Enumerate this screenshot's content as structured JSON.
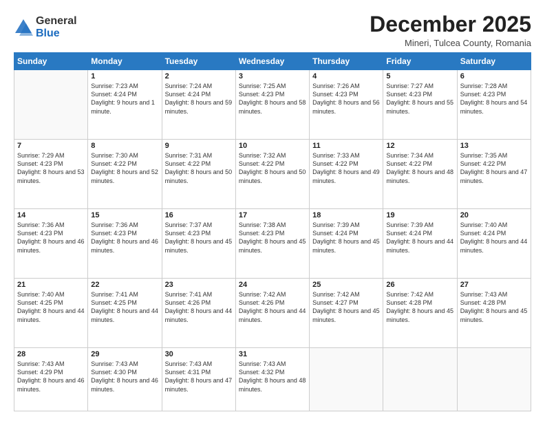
{
  "logo": {
    "general": "General",
    "blue": "Blue"
  },
  "header": {
    "month": "December 2025",
    "location": "Mineri, Tulcea County, Romania"
  },
  "weekdays": [
    "Sunday",
    "Monday",
    "Tuesday",
    "Wednesday",
    "Thursday",
    "Friday",
    "Saturday"
  ],
  "weeks": [
    [
      {
        "day": "",
        "content": ""
      },
      {
        "day": "1",
        "content": "Sunrise: 7:23 AM\nSunset: 4:24 PM\nDaylight: 9 hours\nand 1 minute."
      },
      {
        "day": "2",
        "content": "Sunrise: 7:24 AM\nSunset: 4:24 PM\nDaylight: 8 hours\nand 59 minutes."
      },
      {
        "day": "3",
        "content": "Sunrise: 7:25 AM\nSunset: 4:23 PM\nDaylight: 8 hours\nand 58 minutes."
      },
      {
        "day": "4",
        "content": "Sunrise: 7:26 AM\nSunset: 4:23 PM\nDaylight: 8 hours\nand 56 minutes."
      },
      {
        "day": "5",
        "content": "Sunrise: 7:27 AM\nSunset: 4:23 PM\nDaylight: 8 hours\nand 55 minutes."
      },
      {
        "day": "6",
        "content": "Sunrise: 7:28 AM\nSunset: 4:23 PM\nDaylight: 8 hours\nand 54 minutes."
      }
    ],
    [
      {
        "day": "7",
        "content": "Sunrise: 7:29 AM\nSunset: 4:23 PM\nDaylight: 8 hours\nand 53 minutes."
      },
      {
        "day": "8",
        "content": "Sunrise: 7:30 AM\nSunset: 4:22 PM\nDaylight: 8 hours\nand 52 minutes."
      },
      {
        "day": "9",
        "content": "Sunrise: 7:31 AM\nSunset: 4:22 PM\nDaylight: 8 hours\nand 50 minutes."
      },
      {
        "day": "10",
        "content": "Sunrise: 7:32 AM\nSunset: 4:22 PM\nDaylight: 8 hours\nand 50 minutes."
      },
      {
        "day": "11",
        "content": "Sunrise: 7:33 AM\nSunset: 4:22 PM\nDaylight: 8 hours\nand 49 minutes."
      },
      {
        "day": "12",
        "content": "Sunrise: 7:34 AM\nSunset: 4:22 PM\nDaylight: 8 hours\nand 48 minutes."
      },
      {
        "day": "13",
        "content": "Sunrise: 7:35 AM\nSunset: 4:22 PM\nDaylight: 8 hours\nand 47 minutes."
      }
    ],
    [
      {
        "day": "14",
        "content": "Sunrise: 7:36 AM\nSunset: 4:23 PM\nDaylight: 8 hours\nand 46 minutes."
      },
      {
        "day": "15",
        "content": "Sunrise: 7:36 AM\nSunset: 4:23 PM\nDaylight: 8 hours\nand 46 minutes."
      },
      {
        "day": "16",
        "content": "Sunrise: 7:37 AM\nSunset: 4:23 PM\nDaylight: 8 hours\nand 45 minutes."
      },
      {
        "day": "17",
        "content": "Sunrise: 7:38 AM\nSunset: 4:23 PM\nDaylight: 8 hours\nand 45 minutes."
      },
      {
        "day": "18",
        "content": "Sunrise: 7:39 AM\nSunset: 4:24 PM\nDaylight: 8 hours\nand 45 minutes."
      },
      {
        "day": "19",
        "content": "Sunrise: 7:39 AM\nSunset: 4:24 PM\nDaylight: 8 hours\nand 44 minutes."
      },
      {
        "day": "20",
        "content": "Sunrise: 7:40 AM\nSunset: 4:24 PM\nDaylight: 8 hours\nand 44 minutes."
      }
    ],
    [
      {
        "day": "21",
        "content": "Sunrise: 7:40 AM\nSunset: 4:25 PM\nDaylight: 8 hours\nand 44 minutes."
      },
      {
        "day": "22",
        "content": "Sunrise: 7:41 AM\nSunset: 4:25 PM\nDaylight: 8 hours\nand 44 minutes."
      },
      {
        "day": "23",
        "content": "Sunrise: 7:41 AM\nSunset: 4:26 PM\nDaylight: 8 hours\nand 44 minutes."
      },
      {
        "day": "24",
        "content": "Sunrise: 7:42 AM\nSunset: 4:26 PM\nDaylight: 8 hours\nand 44 minutes."
      },
      {
        "day": "25",
        "content": "Sunrise: 7:42 AM\nSunset: 4:27 PM\nDaylight: 8 hours\nand 45 minutes."
      },
      {
        "day": "26",
        "content": "Sunrise: 7:42 AM\nSunset: 4:28 PM\nDaylight: 8 hours\nand 45 minutes."
      },
      {
        "day": "27",
        "content": "Sunrise: 7:43 AM\nSunset: 4:28 PM\nDaylight: 8 hours\nand 45 minutes."
      }
    ],
    [
      {
        "day": "28",
        "content": "Sunrise: 7:43 AM\nSunset: 4:29 PM\nDaylight: 8 hours\nand 46 minutes."
      },
      {
        "day": "29",
        "content": "Sunrise: 7:43 AM\nSunset: 4:30 PM\nDaylight: 8 hours\nand 46 minutes."
      },
      {
        "day": "30",
        "content": "Sunrise: 7:43 AM\nSunset: 4:31 PM\nDaylight: 8 hours\nand 47 minutes."
      },
      {
        "day": "31",
        "content": "Sunrise: 7:43 AM\nSunset: 4:32 PM\nDaylight: 8 hours\nand 48 minutes."
      },
      {
        "day": "",
        "content": ""
      },
      {
        "day": "",
        "content": ""
      },
      {
        "day": "",
        "content": ""
      }
    ]
  ]
}
